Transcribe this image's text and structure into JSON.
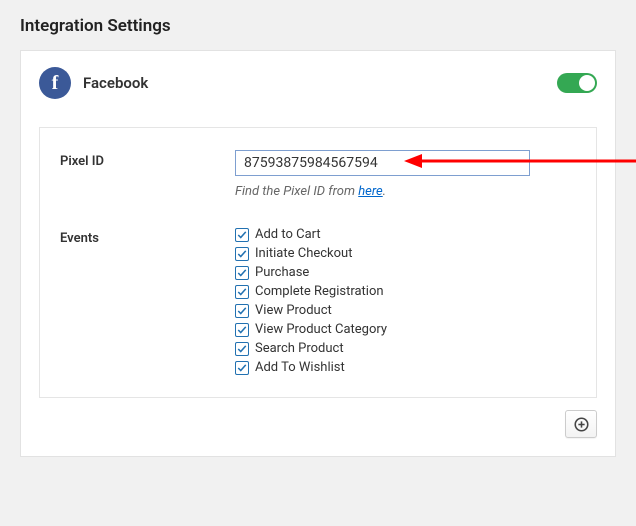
{
  "page_title": "Integration Settings",
  "integration": {
    "name": "Facebook",
    "enabled": true
  },
  "pixel": {
    "label": "Pixel ID",
    "value": "87593875984567594",
    "help_prefix": "Find the Pixel ID from ",
    "help_link_text": "here",
    "help_suffix": "."
  },
  "events": {
    "label": "Events",
    "items": [
      {
        "label": "Add to Cart",
        "checked": true
      },
      {
        "label": "Initiate Checkout",
        "checked": true
      },
      {
        "label": "Purchase",
        "checked": true
      },
      {
        "label": "Complete Registration",
        "checked": true
      },
      {
        "label": "View Product",
        "checked": true
      },
      {
        "label": "View Product Category",
        "checked": true
      },
      {
        "label": "Search Product",
        "checked": true
      },
      {
        "label": "Add To Wishlist",
        "checked": true
      }
    ]
  }
}
